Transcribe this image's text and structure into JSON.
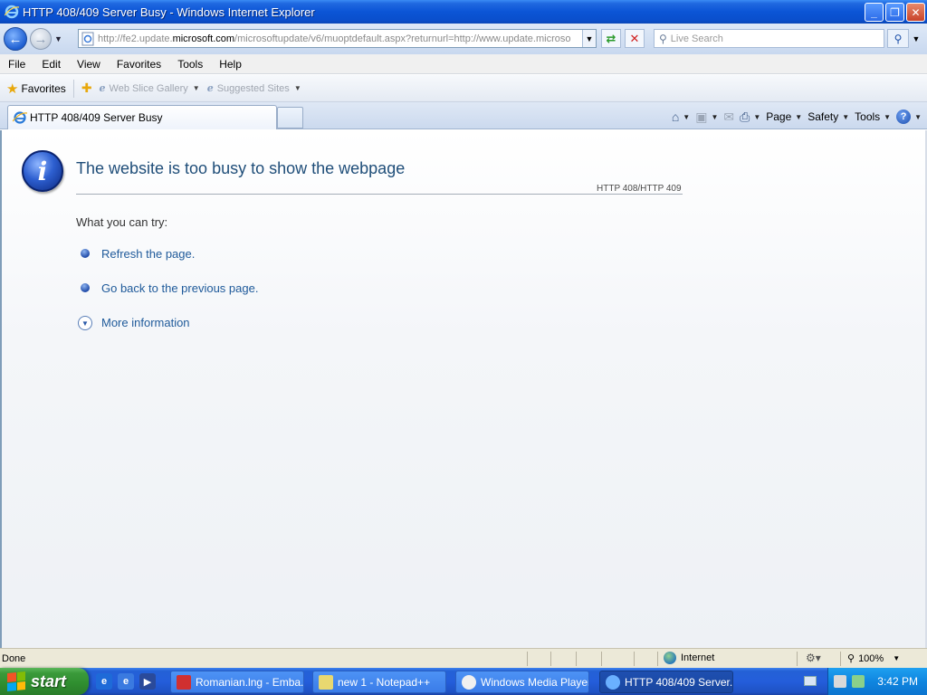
{
  "window": {
    "title": "HTTP 408/409 Server Busy - Windows Internet Explorer",
    "minimize_label": "_",
    "maximize_label": "❐",
    "close_label": "✕"
  },
  "address_bar": {
    "url_prefix": "http://fe2.update.",
    "url_domain": "microsoft.com",
    "url_suffix": "/microsoftupdate/v6/muoptdefault.aspx?returnurl=http://www.update.microso",
    "search_placeholder": "Live Search"
  },
  "menu": [
    "File",
    "Edit",
    "View",
    "Favorites",
    "Tools",
    "Help"
  ],
  "favorites_bar": {
    "favorites_label": "Favorites",
    "web_slice_gallery": "Web Slice Gallery",
    "suggested_sites": "Suggested Sites"
  },
  "tabs": {
    "active_tab": "HTTP 408/409 Server Busy"
  },
  "command_bar": {
    "page": "Page",
    "safety": "Safety",
    "tools": "Tools"
  },
  "page": {
    "heading": "The website is too busy to show the webpage",
    "error_code": "HTTP 408/HTTP 409",
    "try_label": "What you can try:",
    "refresh_link": "Refresh the page.",
    "back_link": "Go back to the previous page.",
    "more_info": "More information"
  },
  "status_bar": {
    "status": "Done",
    "zone": "Internet",
    "zoom": "100%"
  },
  "taskbar": {
    "start_label": "start",
    "buttons": [
      {
        "label": "Romanian.lng - Emba..."
      },
      {
        "label": "new 1 - Notepad++"
      },
      {
        "label": "Windows Media Player"
      },
      {
        "label": "HTTP 408/409 Server..."
      }
    ],
    "clock": "3:42 PM"
  },
  "colors": {
    "title_bar": "#0b55d6",
    "link": "#1f5a9a",
    "heading": "#1f4e79",
    "taskbar": "#245edb",
    "start_button": "#3a9a3a"
  }
}
